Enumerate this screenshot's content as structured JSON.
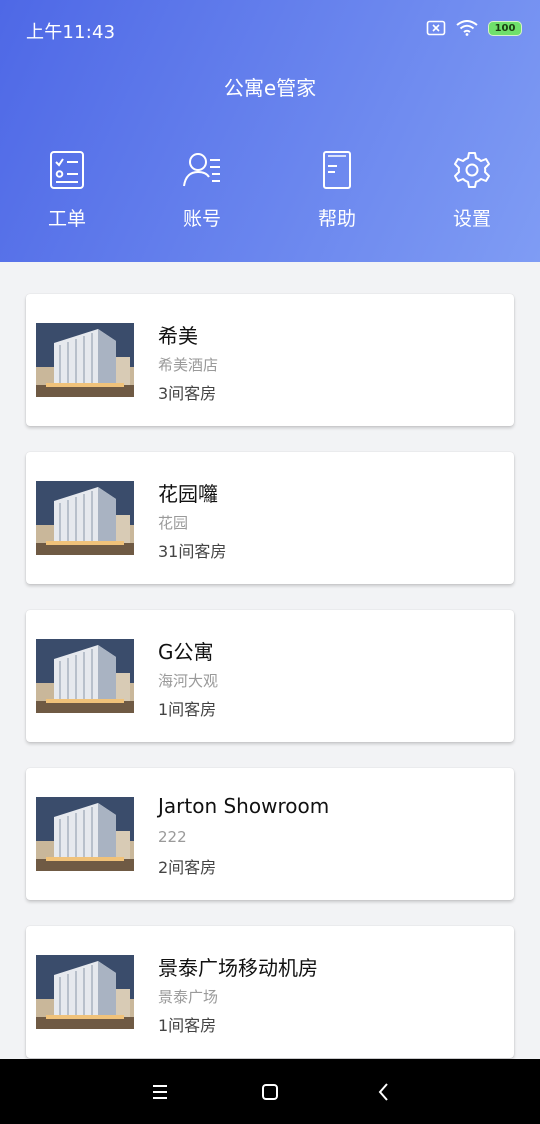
{
  "status_bar": {
    "time": "上午11:43",
    "battery": "100",
    "icons": [
      "sim-off-icon",
      "wifi-icon",
      "battery-icon"
    ]
  },
  "header": {
    "title": "公寓e管家",
    "nav": [
      {
        "label": "工单",
        "icon": "checklist-icon"
      },
      {
        "label": "账号",
        "icon": "user-list-icon"
      },
      {
        "label": "帮助",
        "icon": "book-icon"
      },
      {
        "label": "设置",
        "icon": "gear-icon"
      }
    ]
  },
  "properties": [
    {
      "name": "希美",
      "sub": "希美酒店",
      "rooms": "3间客房"
    },
    {
      "name": "花园囖",
      "sub": "花园",
      "rooms": "31间客房"
    },
    {
      "name": "G公寓",
      "sub": "海河大观",
      "rooms": "1间客房"
    },
    {
      "name": "Jarton Showroom",
      "sub": "222",
      "rooms": "2间客房"
    },
    {
      "name": "景泰广场移动机房",
      "sub": "景泰广场",
      "rooms": "1间客房"
    }
  ],
  "system_nav": {
    "buttons": [
      "menu-icon",
      "home-icon",
      "back-icon"
    ]
  },
  "colors": {
    "header_start": "#4e68e6",
    "header_end": "#7f9cf4",
    "background": "#f2f3f5"
  }
}
